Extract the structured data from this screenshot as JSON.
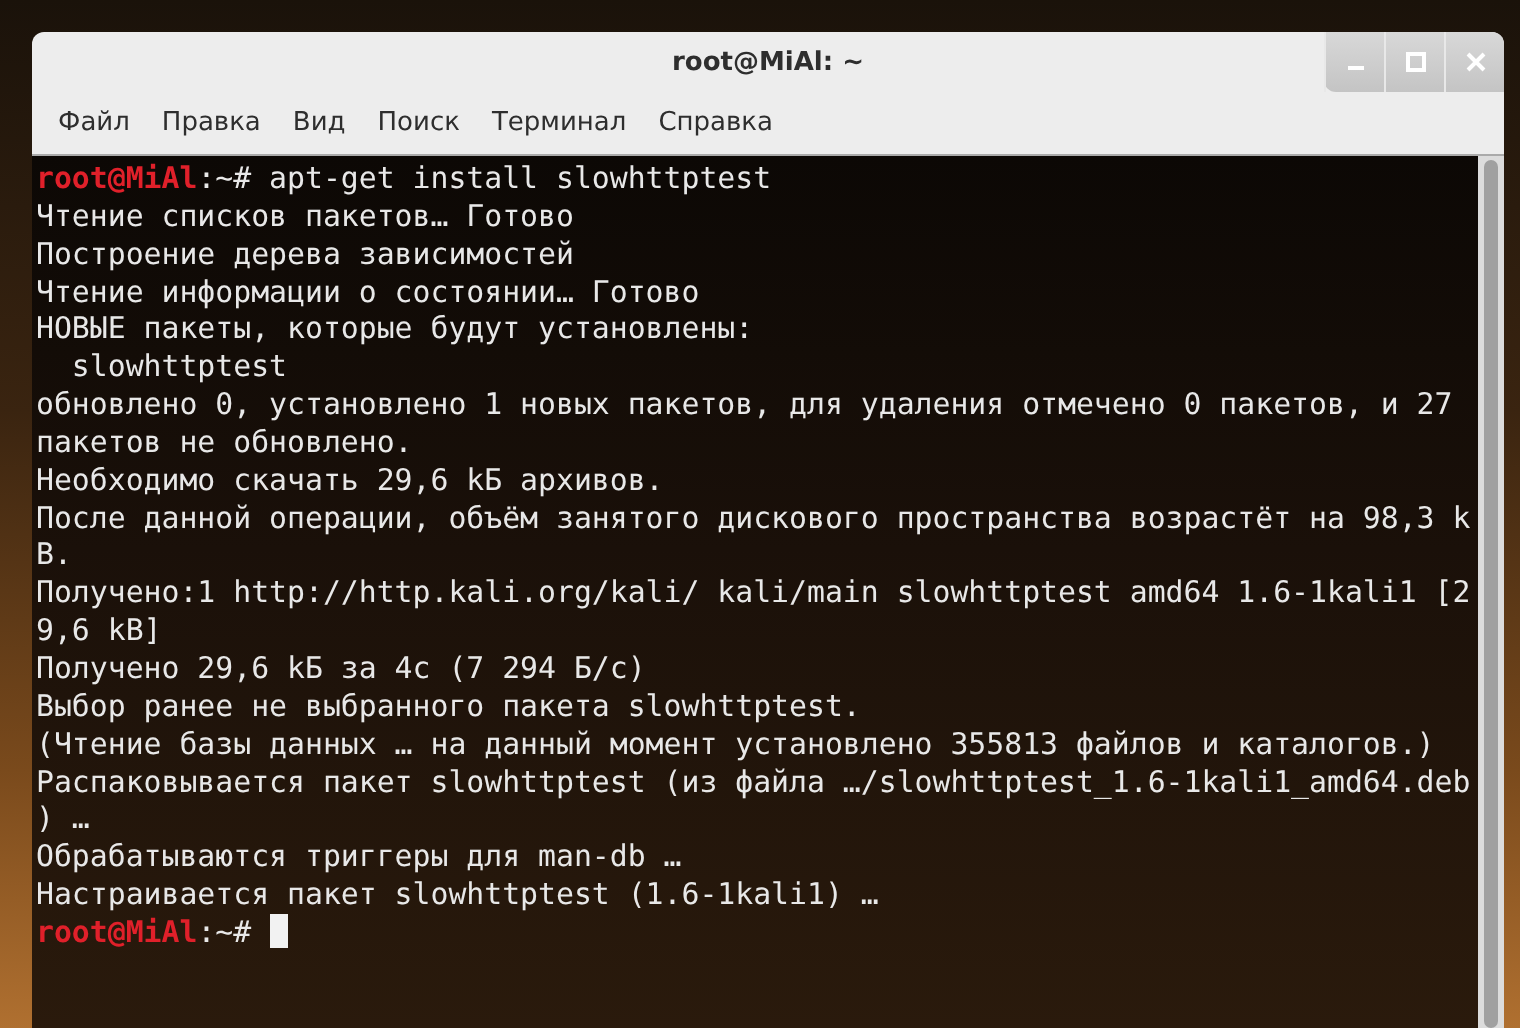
{
  "window": {
    "title": "root@MiAl: ~"
  },
  "menu": [
    "Файл",
    "Правка",
    "Вид",
    "Поиск",
    "Терминал",
    "Справка"
  ],
  "terminal": {
    "lines": [
      {
        "kind": "prompt",
        "prompt": "root@MiAl",
        "rest": ":~# apt-get install slowhttptest",
        "cursor": false
      },
      {
        "kind": "output",
        "text": "Чтение списков пакетов… Готово"
      },
      {
        "kind": "output",
        "text": "Построение дерева зависимостей"
      },
      {
        "kind": "output",
        "text": "Чтение информации о состоянии… Готово"
      },
      {
        "kind": "output",
        "text": "НОВЫЕ пакеты, которые будут установлены:"
      },
      {
        "kind": "output",
        "text": "  slowhttptest"
      },
      {
        "kind": "output",
        "text": "обновлено 0, установлено 1 новых пакетов, для удаления отмечено 0 пакетов, и 27"
      },
      {
        "kind": "output",
        "text": "пакетов не обновлено."
      },
      {
        "kind": "output",
        "text": "Необходимо скачать 29,6 kБ архивов."
      },
      {
        "kind": "output",
        "text": "После данной операции, объём занятого дискового пространства возрастёт на 98,3 k"
      },
      {
        "kind": "output",
        "text": "B."
      },
      {
        "kind": "output",
        "text": "Получено:1 http://http.kali.org/kali/ kali/main slowhttptest amd64 1.6-1kali1 [2"
      },
      {
        "kind": "output",
        "text": "9,6 kB]"
      },
      {
        "kind": "output",
        "text": "Получено 29,6 kБ за 4с (7 294 Б/c)"
      },
      {
        "kind": "output",
        "text": "Выбор ранее не выбранного пакета slowhttptest."
      },
      {
        "kind": "output",
        "text": "(Чтение базы данных … на данный момент установлено 355813 файлов и каталогов.)"
      },
      {
        "kind": "output",
        "text": "Распаковывается пакет slowhttptest (из файла …/slowhttptest_1.6-1kali1_amd64.deb"
      },
      {
        "kind": "output",
        "text": ") …"
      },
      {
        "kind": "output",
        "text": "Обрабатываются триггеры для man-db …"
      },
      {
        "kind": "output",
        "text": "Настраивается пакет slowhttptest (1.6-1kali1) …"
      },
      {
        "kind": "prompt",
        "prompt": "root@MiAl",
        "rest": ":~# ",
        "cursor": true
      }
    ]
  }
}
